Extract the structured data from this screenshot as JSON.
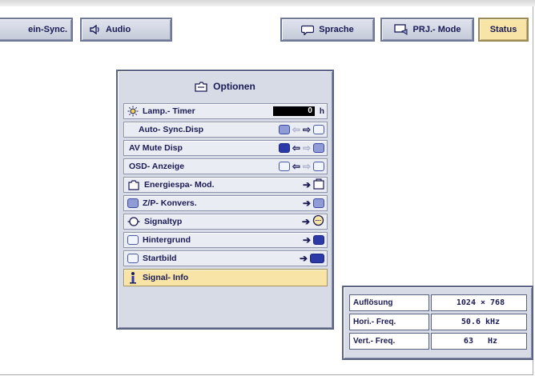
{
  "tabs": {
    "sync": "ein-Sync.",
    "audio": "Audio",
    "sprache": "Sprache",
    "prj": "PRJ.- Mode",
    "status": "Status"
  },
  "panel": {
    "title": "Optionen",
    "rows": [
      {
        "label": "Lamp.- Timer",
        "value": "0",
        "unit": "h"
      },
      {
        "label": "Auto- Sync.Disp"
      },
      {
        "label": "AV Mute Disp"
      },
      {
        "label": "OSD- Anzeige"
      },
      {
        "label": "Energiespa- Mod."
      },
      {
        "label": "Z/P- Konvers."
      },
      {
        "label": "Signaltyp"
      },
      {
        "label": "Hintergrund"
      },
      {
        "label": "Startbild"
      },
      {
        "label": "Signal- Info"
      }
    ]
  },
  "info": {
    "rows": [
      {
        "key": "Auflösung",
        "value": "1024 × 768"
      },
      {
        "key": "Hori.- Freq.",
        "value": "50.6 kHz"
      },
      {
        "key": "Vert.- Freq.",
        "value": "63   Hz"
      }
    ]
  },
  "colors": {
    "accent": "#f7e4a6",
    "panel": "#d7dbe6",
    "border": "#5a6384",
    "text": "#1a1a55"
  }
}
